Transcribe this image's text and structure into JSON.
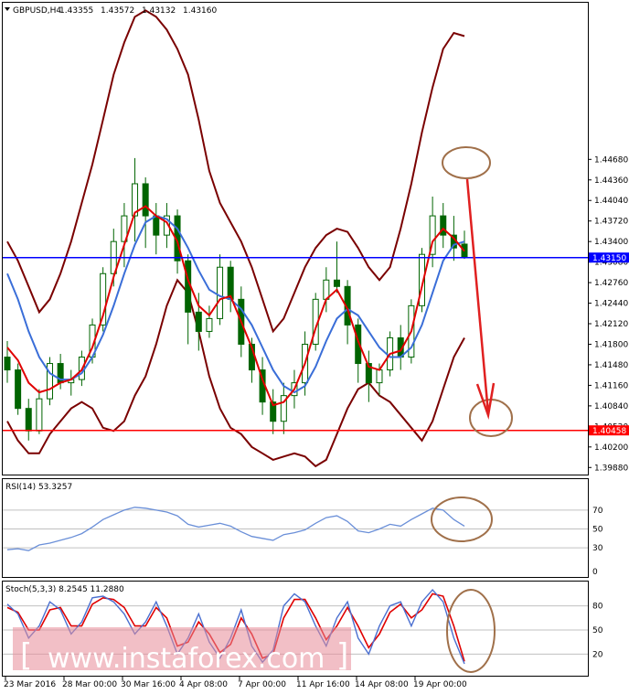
{
  "chart_data": {
    "type": "candlestick",
    "symbol_header": "GBPUSD,H4",
    "ohlc_header": [
      "1.43355",
      "1.43572",
      "1.43132",
      "1.43160"
    ],
    "price_axis": {
      "ylim": [
        1.3977,
        1.4712
      ],
      "ticks": [
        "1.44680",
        "1.44360",
        "1.44040",
        "1.43720",
        "1.43400",
        "1.43080",
        "1.42760",
        "1.42440",
        "1.42120",
        "1.41800",
        "1.41480",
        "1.41160",
        "1.40840",
        "1.40520",
        "1.40200",
        "1.39880"
      ]
    },
    "time_labels": [
      "23 Mar 2016",
      "28 Mar 00:00",
      "30 Mar 16:00",
      "4 Apr 08:00",
      "7 Apr 00:00",
      "11 Apr 16:00",
      "14 Apr 08:00",
      "19 Apr 00:00"
    ],
    "candles": [
      [
        1.416,
        1.4185,
        1.412,
        1.414
      ],
      [
        1.414,
        1.415,
        1.407,
        1.408
      ],
      [
        1.408,
        1.4095,
        1.403,
        1.4045
      ],
      [
        1.4045,
        1.411,
        1.404,
        1.4095
      ],
      [
        1.4095,
        1.416,
        1.4085,
        1.415
      ],
      [
        1.415,
        1.4165,
        1.411,
        1.412
      ],
      [
        1.412,
        1.414,
        1.41,
        1.4125
      ],
      [
        1.4125,
        1.417,
        1.4115,
        1.416
      ],
      [
        1.416,
        1.422,
        1.415,
        1.421
      ],
      [
        1.421,
        1.43,
        1.42,
        1.429
      ],
      [
        1.429,
        1.436,
        1.427,
        1.434
      ],
      [
        1.434,
        1.44,
        1.43,
        1.438
      ],
      [
        1.438,
        1.447,
        1.434,
        1.443
      ],
      [
        1.443,
        1.444,
        1.433,
        1.438
      ],
      [
        1.438,
        1.44,
        1.432,
        1.435
      ],
      [
        1.435,
        1.44,
        1.433,
        1.438
      ],
      [
        1.438,
        1.439,
        1.429,
        1.431
      ],
      [
        1.431,
        1.432,
        1.418,
        1.423
      ],
      [
        1.423,
        1.426,
        1.417,
        1.42
      ],
      [
        1.42,
        1.424,
        1.419,
        1.422
      ],
      [
        1.422,
        1.432,
        1.421,
        1.43
      ],
      [
        1.43,
        1.431,
        1.423,
        1.425
      ],
      [
        1.425,
        1.427,
        1.416,
        1.418
      ],
      [
        1.418,
        1.419,
        1.412,
        1.414
      ],
      [
        1.414,
        1.416,
        1.407,
        1.409
      ],
      [
        1.409,
        1.411,
        1.404,
        1.406
      ],
      [
        1.406,
        1.412,
        1.404,
        1.41
      ],
      [
        1.41,
        1.414,
        1.408,
        1.412
      ],
      [
        1.412,
        1.42,
        1.41,
        1.418
      ],
      [
        1.418,
        1.426,
        1.417,
        1.425
      ],
      [
        1.425,
        1.43,
        1.423,
        1.428
      ],
      [
        1.428,
        1.434,
        1.426,
        1.427
      ],
      [
        1.427,
        1.428,
        1.418,
        1.421
      ],
      [
        1.421,
        1.422,
        1.412,
        1.415
      ],
      [
        1.415,
        1.417,
        1.409,
        1.412
      ],
      [
        1.412,
        1.415,
        1.41,
        1.414
      ],
      [
        1.414,
        1.42,
        1.413,
        1.419
      ],
      [
        1.419,
        1.421,
        1.414,
        1.416
      ],
      [
        1.416,
        1.425,
        1.415,
        1.424
      ],
      [
        1.424,
        1.433,
        1.423,
        1.432
      ],
      [
        1.432,
        1.441,
        1.43,
        1.438
      ],
      [
        1.438,
        1.44,
        1.433,
        1.435
      ],
      [
        1.435,
        1.438,
        1.431,
        1.433
      ],
      [
        1.4336,
        1.4357,
        1.4313,
        1.4316
      ]
    ],
    "ma_fast": [
      1.4175,
      1.4155,
      1.412,
      1.4105,
      1.411,
      1.412,
      1.4125,
      1.414,
      1.4175,
      1.4225,
      1.4285,
      1.4335,
      1.4385,
      1.4395,
      1.438,
      1.437,
      1.434,
      1.428,
      1.424,
      1.4225,
      1.425,
      1.4255,
      1.4215,
      1.4175,
      1.4125,
      1.4085,
      1.409,
      1.411,
      1.415,
      1.4205,
      1.425,
      1.4265,
      1.4235,
      1.4185,
      1.4145,
      1.414,
      1.4165,
      1.417,
      1.42,
      1.427,
      1.434,
      1.436,
      1.4345,
      1.4325
    ],
    "ma_mid": [
      1.429,
      1.425,
      1.42,
      1.416,
      1.4135,
      1.4125,
      1.4125,
      1.4135,
      1.416,
      1.4195,
      1.424,
      1.429,
      1.4335,
      1.437,
      1.438,
      1.4375,
      1.436,
      1.433,
      1.4295,
      1.4265,
      1.4255,
      1.425,
      1.4235,
      1.421,
      1.4175,
      1.414,
      1.4115,
      1.4105,
      1.4115,
      1.4145,
      1.4185,
      1.422,
      1.4235,
      1.4225,
      1.42,
      1.4175,
      1.416,
      1.416,
      1.4175,
      1.421,
      1.426,
      1.431,
      1.4335,
      1.434
    ],
    "band_upper": [
      1.434,
      1.431,
      1.427,
      1.423,
      1.425,
      1.429,
      1.434,
      1.44,
      1.446,
      1.453,
      1.46,
      1.465,
      1.469,
      1.47,
      1.469,
      1.467,
      1.464,
      1.46,
      1.453,
      1.445,
      1.44,
      1.437,
      1.434,
      1.43,
      1.425,
      1.42,
      1.422,
      1.426,
      1.43,
      1.433,
      1.435,
      1.436,
      1.4355,
      1.433,
      1.43,
      1.428,
      1.43,
      1.436,
      1.443,
      1.451,
      1.458,
      1.464,
      1.4665,
      1.466
    ],
    "band_lower": [
      1.406,
      1.403,
      1.401,
      1.401,
      1.404,
      1.406,
      1.408,
      1.409,
      1.408,
      1.405,
      1.4045,
      1.406,
      1.41,
      1.413,
      1.418,
      1.424,
      1.428,
      1.426,
      1.42,
      1.413,
      1.408,
      1.405,
      1.404,
      1.402,
      1.401,
      1.4,
      1.4005,
      1.401,
      1.4005,
      1.399,
      1.4,
      1.404,
      1.408,
      1.411,
      1.412,
      1.41,
      1.409,
      1.407,
      1.405,
      1.403,
      1.406,
      1.411,
      1.416,
      1.419
    ],
    "level_blue": {
      "value": 1.4315,
      "label": "1.43150",
      "color": "#0000ff"
    },
    "level_red": {
      "value": 1.40458,
      "label": "1.40458",
      "color": "#ff0000"
    },
    "rsi": {
      "label": "RSI(14) 53.3257",
      "ylim": [
        0,
        100
      ],
      "ticks": [
        "70",
        "50",
        "30",
        "0"
      ],
      "values": [
        28,
        29,
        27,
        33,
        35,
        38,
        41,
        45,
        52,
        60,
        65,
        70,
        73,
        72,
        70,
        68,
        64,
        55,
        52,
        54,
        56,
        53,
        47,
        42,
        40,
        38,
        44,
        46,
        49,
        56,
        62,
        64,
        58,
        48,
        46,
        50,
        55,
        53,
        60,
        66,
        72,
        70,
        60,
        53
      ]
    },
    "stoch": {
      "label": "Stoch(5,3,3) 8.2545 11.2880",
      "ylim": [
        0,
        100
      ],
      "ticks": [
        "80",
        "50",
        "20"
      ],
      "k": [
        82,
        70,
        40,
        55,
        85,
        75,
        45,
        60,
        90,
        92,
        85,
        70,
        45,
        60,
        85,
        55,
        20,
        40,
        70,
        35,
        15,
        40,
        75,
        30,
        10,
        25,
        80,
        95,
        85,
        55,
        30,
        65,
        85,
        40,
        20,
        55,
        80,
        85,
        55,
        85,
        100,
        85,
        40,
        8
      ],
      "d": [
        78,
        72,
        50,
        50,
        75,
        78,
        55,
        55,
        82,
        90,
        88,
        78,
        55,
        55,
        78,
        65,
        30,
        35,
        60,
        45,
        22,
        32,
        65,
        45,
        15,
        20,
        65,
        88,
        88,
        65,
        38,
        55,
        78,
        55,
        28,
        45,
        72,
        82,
        65,
        75,
        95,
        92,
        55,
        11
      ]
    }
  },
  "colors": {
    "candle": "#006400",
    "ma_fast": "#e00000",
    "ma_mid": "#3a6ed8",
    "band": "#7a0000",
    "rsi_line": "#6a8fd8",
    "stoch_k": "#4a6fd0",
    "stoch_d": "#e00000",
    "circle": "#a0704a",
    "arrow": "#e02020",
    "grid_level": "#c0c0c0"
  },
  "watermark": {
    "text": "www.instaforex.com",
    "left_bracket": "[",
    "right_bracket": "]"
  }
}
